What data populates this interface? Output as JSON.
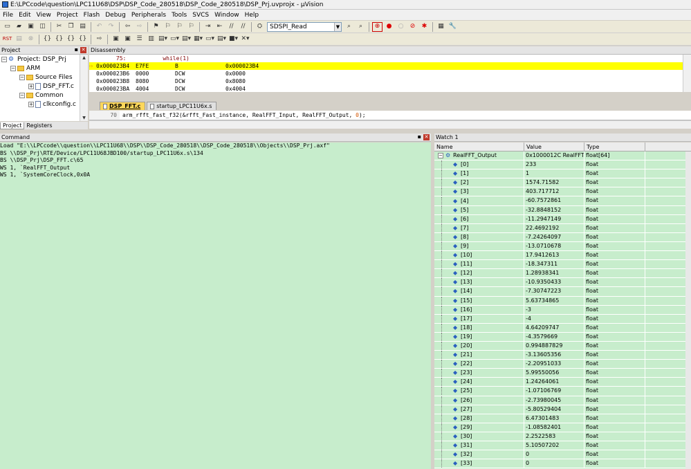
{
  "title": "E:\\LPCcode\\question\\LPC11U68\\DSP\\DSP_Code_280518\\DSP_Code_280518\\DSP_Prj.uvprojx - µVision",
  "menu": [
    "File",
    "Edit",
    "View",
    "Project",
    "Flash",
    "Debug",
    "Peripherals",
    "Tools",
    "SVCS",
    "Window",
    "Help"
  ],
  "toolbar": {
    "target_combo": "SDSPI_Read",
    "row2_first": "RST"
  },
  "project_panel": {
    "title": "Project",
    "tree": [
      {
        "label": "Project: DSP_Prj",
        "level": 0,
        "kind": "project"
      },
      {
        "label": "ARM",
        "level": 1,
        "kind": "folder"
      },
      {
        "label": "Source Files",
        "level": 2,
        "kind": "folder"
      },
      {
        "label": "DSP_FFT.c",
        "level": 3,
        "kind": "file"
      },
      {
        "label": "Common",
        "level": 2,
        "kind": "folder"
      },
      {
        "label": "clkconfig.c",
        "level": 3,
        "kind": "file"
      }
    ],
    "tabs": [
      "Project",
      "Registers"
    ]
  },
  "disassembly": {
    "title": "Disassembly",
    "source_line": "      75:           while(1)",
    "lines": [
      {
        "addr": "0x000023B4",
        "code": "E7FE",
        "mnem": "B",
        "operand": "0x000023B4",
        "current": true
      },
      {
        "addr": "0x000023B6",
        "code": "0000",
        "mnem": "DCW",
        "operand": "0x0000",
        "current": false
      },
      {
        "addr": "0x000023B8",
        "code": "8080",
        "mnem": "DCW",
        "operand": "0x8080",
        "current": false
      },
      {
        "addr": "0x000023BA",
        "code": "4004",
        "mnem": "DCW",
        "operand": "0x4004",
        "current": false
      }
    ]
  },
  "editor": {
    "tabs": [
      "DSP_FFT.c",
      "startup_LPC11U6x.s"
    ],
    "line_no": "70",
    "code_before": "arm_rfft_fast_f32(&rfft_Fast_instance, RealFFT_Input, RealFFT_Output, ",
    "code_num": "0",
    "code_after": ");"
  },
  "command": {
    "title": "Command",
    "lines": [
      "Load \"E:\\\\LPCcode\\\\question\\\\LPC11U68\\\\DSP\\\\DSP_Code_280518\\\\DSP_Code_280518\\\\Objects\\\\DSP_Prj.axf\"",
      "BS \\\\DSP_Prj\\RTE/Device/LPC11U68JBD100/startup_LPC11U6x.s\\134",
      "BS \\\\DSP_Prj\\DSP_FFT.c\\65",
      "WS 1, `RealFFT_Output",
      "WS 1, `SystemCoreClock,0x0A"
    ]
  },
  "watch": {
    "title": "Watch 1",
    "headers": [
      "Name",
      "Value",
      "Type"
    ],
    "root": {
      "name": "RealFFT_Output",
      "value": "0x1000012C RealFFT_...",
      "type": "float[64]"
    },
    "rows": [
      [
        "[0]",
        "233",
        "float"
      ],
      [
        "[1]",
        "1",
        "float"
      ],
      [
        "[2]",
        "1574.71582",
        "float"
      ],
      [
        "[3]",
        "403.717712",
        "float"
      ],
      [
        "[4]",
        "-60.7572861",
        "float"
      ],
      [
        "[5]",
        "-32.8848152",
        "float"
      ],
      [
        "[6]",
        "-11.2947149",
        "float"
      ],
      [
        "[7]",
        "22.4692192",
        "float"
      ],
      [
        "[8]",
        "-7.24264097",
        "float"
      ],
      [
        "[9]",
        "-13.0710678",
        "float"
      ],
      [
        "[10]",
        "17.9412613",
        "float"
      ],
      [
        "[11]",
        "-18.347311",
        "float"
      ],
      [
        "[12]",
        "1.28938341",
        "float"
      ],
      [
        "[13]",
        "-10.9350433",
        "float"
      ],
      [
        "[14]",
        "-7.30747223",
        "float"
      ],
      [
        "[15]",
        "5.63734865",
        "float"
      ],
      [
        "[16]",
        "-3",
        "float"
      ],
      [
        "[17]",
        "-4",
        "float"
      ],
      [
        "[18]",
        "4.64209747",
        "float"
      ],
      [
        "[19]",
        "-4.3579669",
        "float"
      ],
      [
        "[20]",
        "0.994887829",
        "float"
      ],
      [
        "[21]",
        "-3.13605356",
        "float"
      ],
      [
        "[22]",
        "-2.20951033",
        "float"
      ],
      [
        "[23]",
        "5.99550056",
        "float"
      ],
      [
        "[24]",
        "1.24264061",
        "float"
      ],
      [
        "[25]",
        "-1.07106769",
        "float"
      ],
      [
        "[26]",
        "-2.73980045",
        "float"
      ],
      [
        "[27]",
        "-5.80529404",
        "float"
      ],
      [
        "[28]",
        "6.47301483",
        "float"
      ],
      [
        "[29]",
        "-1.08582401",
        "float"
      ],
      [
        "[30]",
        "2.2522583",
        "float"
      ],
      [
        "[31]",
        "5.10507202",
        "float"
      ],
      [
        "[32]",
        "0",
        "float"
      ],
      [
        "[33]",
        "0",
        "float"
      ]
    ]
  }
}
